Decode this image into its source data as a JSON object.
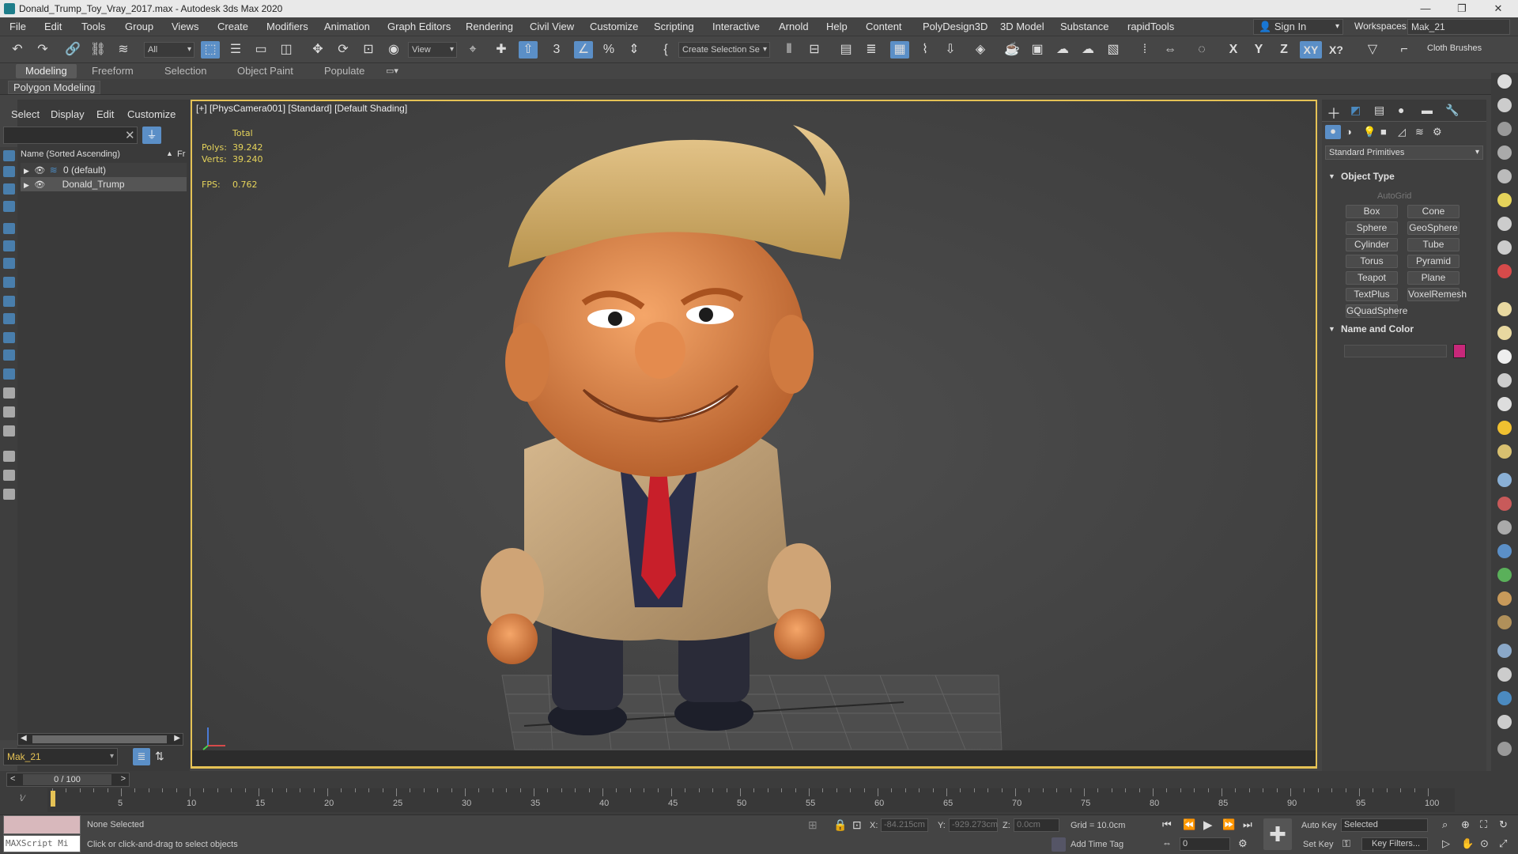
{
  "window": {
    "title": "Donald_Trump_Toy_Vray_2017.max - Autodesk 3ds Max 2020",
    "min": "—",
    "restore": "❐",
    "close": "✕"
  },
  "menu": [
    "File",
    "Edit",
    "Tools",
    "Group",
    "Views",
    "Create",
    "Modifiers",
    "Animation",
    "Graph Editors",
    "Rendering",
    "Civil View",
    "Customize",
    "Scripting",
    "Interactive",
    "Arnold",
    "Help",
    "Content",
    "PolyDesign3D",
    "3D Model",
    "Substance",
    "rapidTools"
  ],
  "account": {
    "sign_in": "Sign In",
    "workspaces_label": "Workspaces:",
    "workspace": "Mak_21"
  },
  "toolbar": {
    "filter_value": "All",
    "refcoord_value": "View",
    "selection_set": "Create Selection Se",
    "axis_x": "X",
    "axis_y": "Y",
    "axis_z": "Z",
    "axis_xy": "XY",
    "axis_xq": "X?",
    "cloth": "Cloth Brushes"
  },
  "ribbon": {
    "tabs": [
      "Modeling",
      "Freeform",
      "Selection",
      "Object Paint",
      "Populate"
    ],
    "sub": "Polygon Modeling"
  },
  "scene_explorer": {
    "menu": [
      "Select",
      "Display",
      "Edit",
      "Customize"
    ],
    "column": "Name (Sorted Ascending)",
    "column2": "Fr",
    "rows": [
      "0 (default)",
      "Donald_Trump"
    ],
    "layer": "Mak_21"
  },
  "viewport": {
    "label": "[+] [PhysCamera001] [Standard] [Default Shading]",
    "stats": {
      "total": "Total",
      "polys_label": "Polys:",
      "polys": "39.242",
      "verts_label": "Verts:",
      "verts": "39.240",
      "fps_label": "FPS:",
      "fps": "0.762"
    }
  },
  "command_panel": {
    "dropdown": "Standard Primitives",
    "object_type": "Object Type",
    "autogrid": "AutoGrid",
    "buttons": [
      "Box",
      "Cone",
      "Sphere",
      "GeoSphere",
      "Cylinder",
      "Tube",
      "Torus",
      "Pyramid",
      "Teapot",
      "Plane",
      "TextPlus",
      "VoxelRemesh",
      "GQuadSphere"
    ],
    "name_color": "Name and Color",
    "color": "#c8287a"
  },
  "timeline": {
    "frame": "0 / 100",
    "ticks": [
      "5",
      "10",
      "15",
      "20",
      "25",
      "30",
      "35",
      "40",
      "45",
      "50",
      "55",
      "60",
      "65",
      "70",
      "75",
      "80",
      "85",
      "90",
      "95",
      "100"
    ]
  },
  "status": {
    "script": "MAXScript Mi",
    "selection": "None Selected",
    "prompt": "Click or click-and-drag to select objects",
    "x_label": "X:",
    "x": "-84.215cm",
    "y_label": "Y:",
    "y": "-929.273cm",
    "z_label": "Z:",
    "z": "0.0cm",
    "grid": "Grid = 10.0cm",
    "add_time_tag": "Add Time Tag",
    "auto_key": "Auto Key",
    "set_key": "Set Key",
    "key_mode": "Selected",
    "key_filters": "Key Filters...",
    "frame_field": "0"
  }
}
